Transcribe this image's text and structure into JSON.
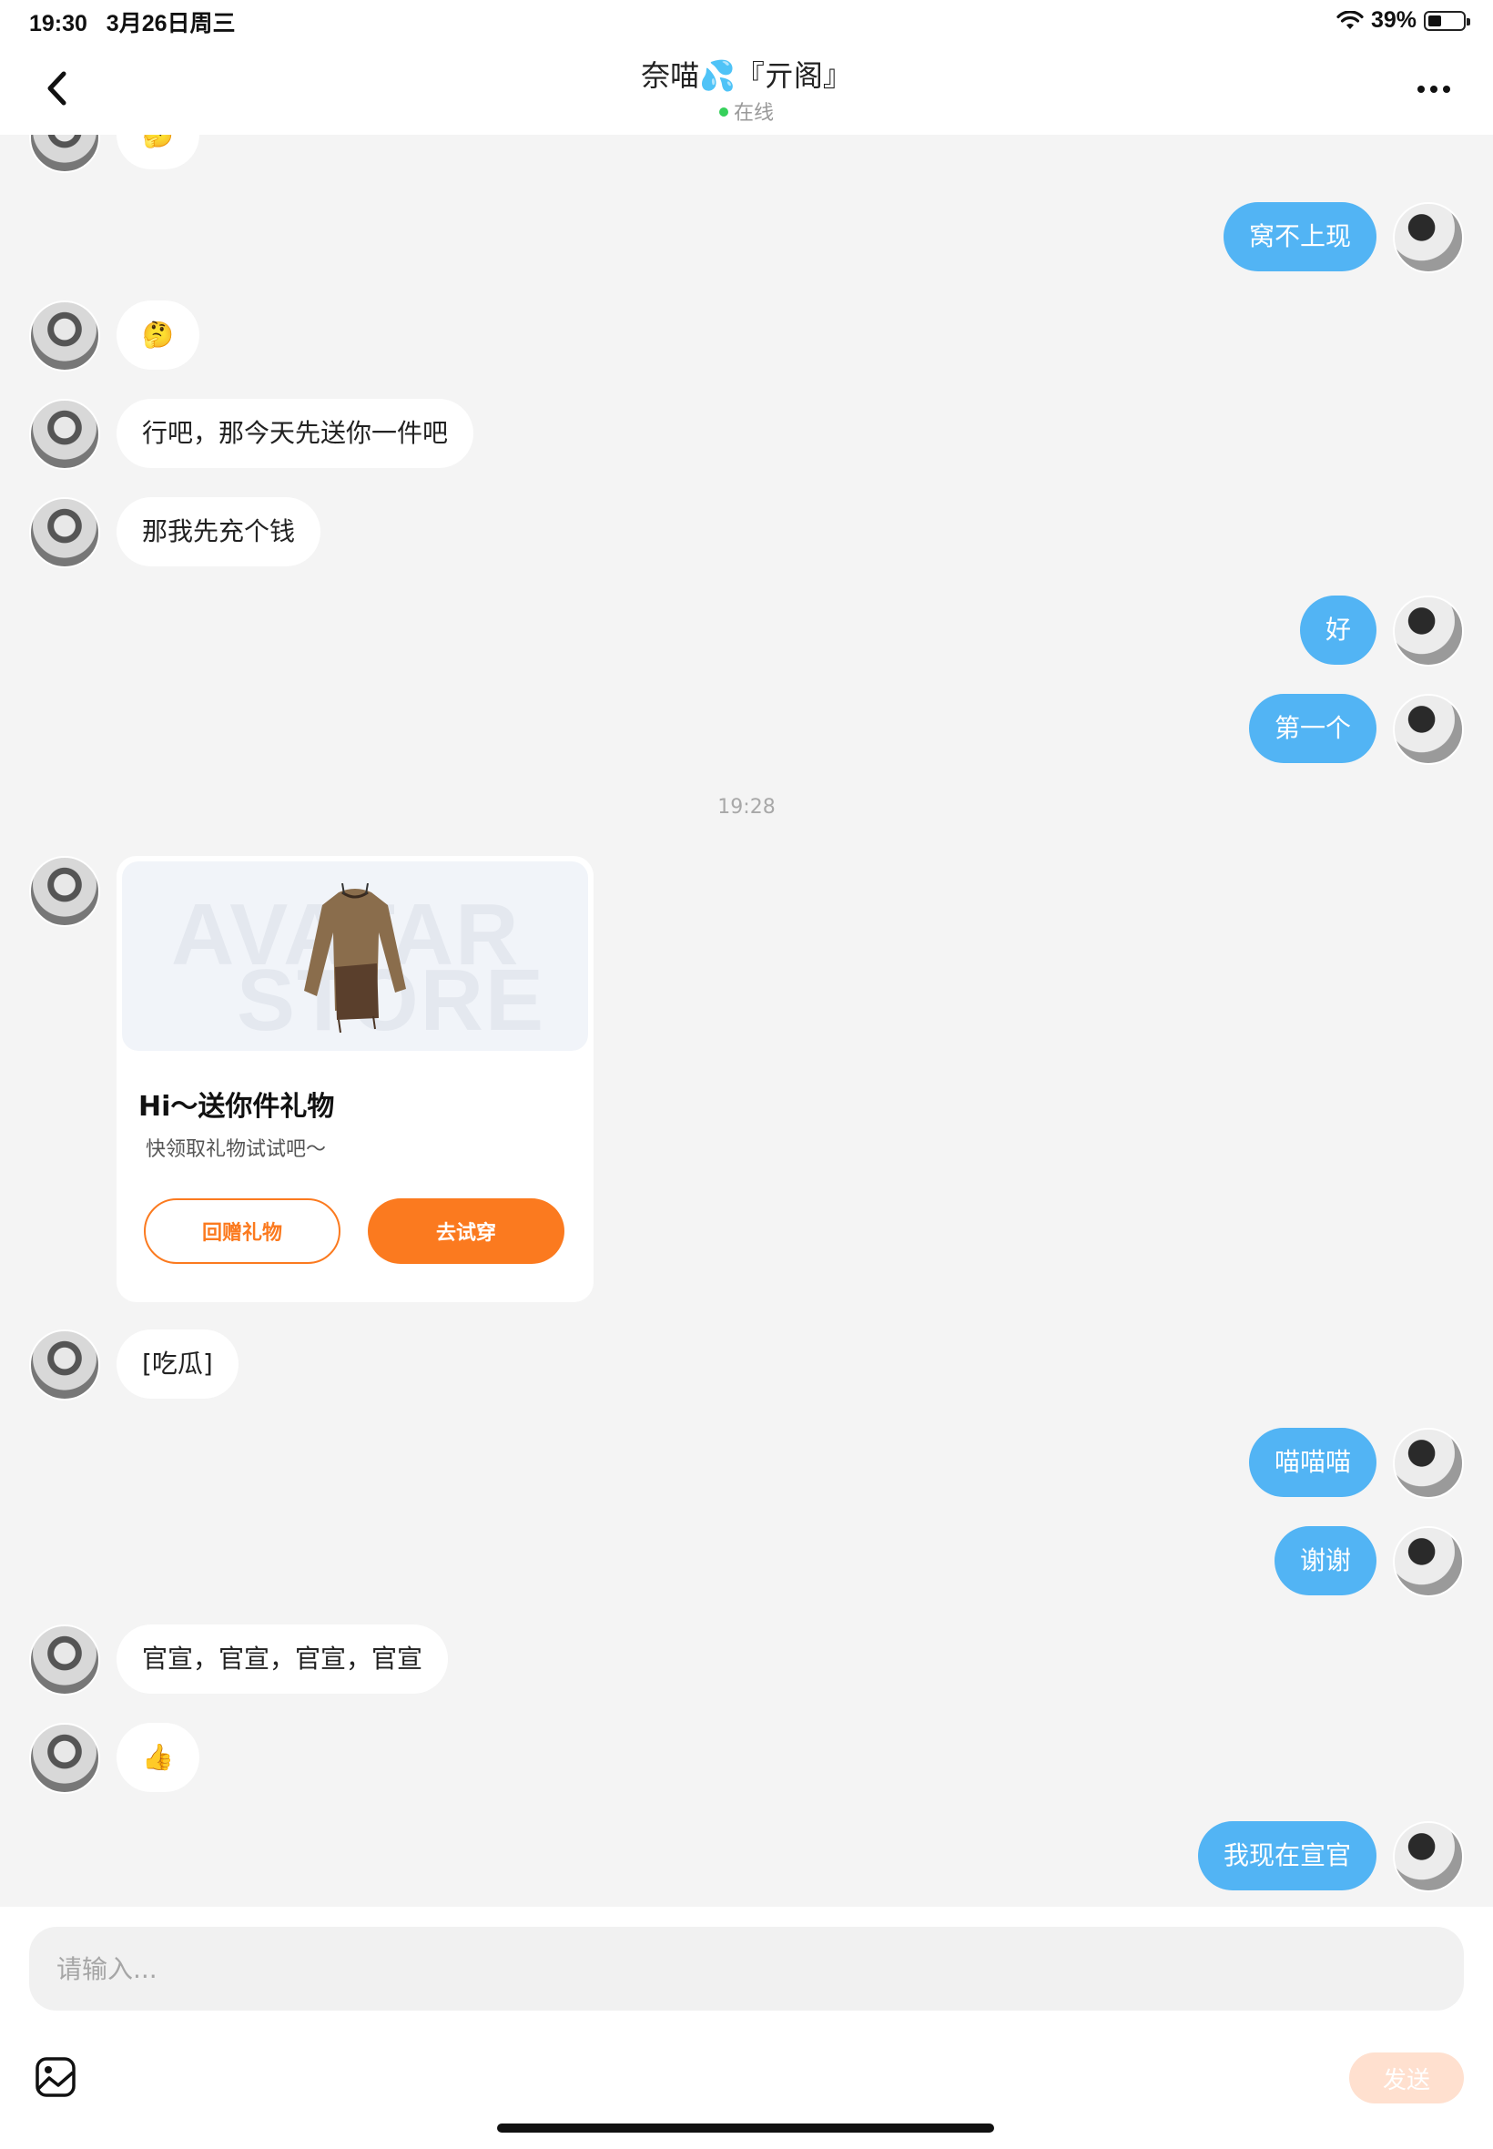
{
  "status_bar": {
    "time": "19:30",
    "date": "3月26日周三",
    "battery": "39%",
    "battery_level": 0.39
  },
  "header": {
    "title_name": "奈喵",
    "title_emoji": "💦",
    "title_suffix": "『亓阁』",
    "status": "在线"
  },
  "messages": [
    {
      "from": "other",
      "text": "🤔"
    },
    {
      "from": "me",
      "text": "窝不上现"
    },
    {
      "from": "other",
      "text": "🤔"
    },
    {
      "from": "other",
      "text": "行吧，那今天先送你一件吧"
    },
    {
      "from": "other",
      "text": "那我先充个钱"
    },
    {
      "from": "me",
      "text": "好"
    },
    {
      "from": "me",
      "text": "第一个"
    },
    {
      "from": "other",
      "text": "[吃瓜]"
    },
    {
      "from": "me",
      "text": "喵喵喵"
    },
    {
      "from": "me",
      "text": "谢谢"
    },
    {
      "from": "other",
      "text": "官宣，官宣，官宣，官宣"
    },
    {
      "from": "other",
      "text": "👍"
    },
    {
      "from": "me",
      "text": "我现在宣官"
    }
  ],
  "time_divider": "19:28",
  "gift_card": {
    "watermark_line1": "AVATAR",
    "watermark_line2": "STORE",
    "title": "Hi～送你件礼物",
    "subtitle": "快领取礼物试试吧～",
    "return_label": "回赠礼物",
    "try_label": "去试穿"
  },
  "input": {
    "placeholder": "请输入...",
    "value": "",
    "send_label": "发送"
  },
  "colors": {
    "accent": "#fb7a1f",
    "my_bubble": "#52b4f4",
    "online_dot": "#35d05a",
    "send_disabled": "#ffe0cf"
  }
}
